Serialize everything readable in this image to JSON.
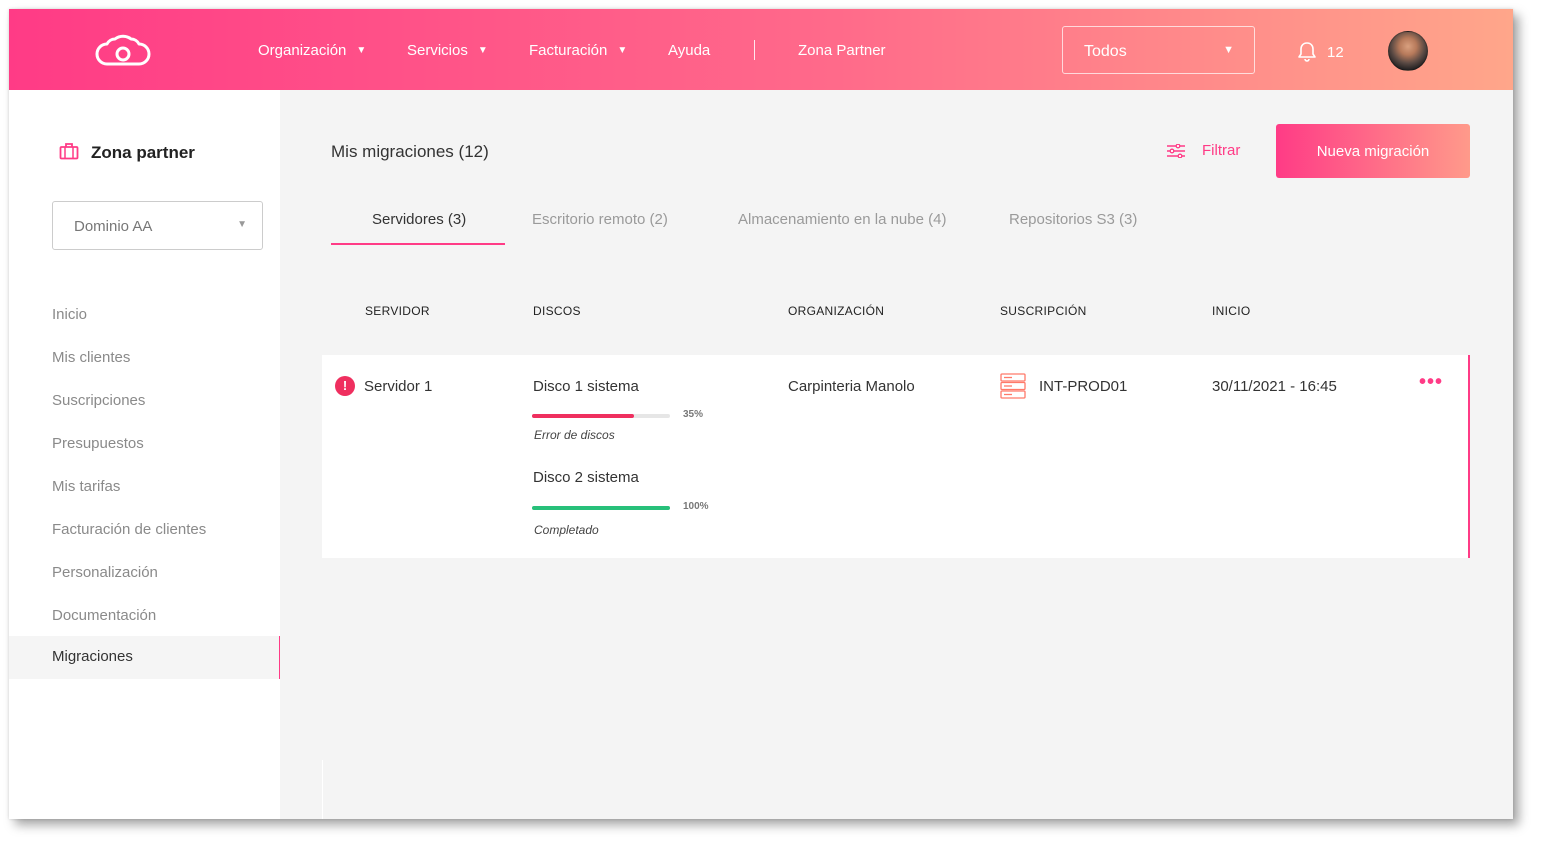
{
  "topbar": {
    "nav": [
      "Organización",
      "Servicios",
      "Facturación",
      "Ayuda",
      "Zona Partner"
    ],
    "org_select": "Todos",
    "notifications": "12"
  },
  "sidebar": {
    "title": "Zona partner",
    "domain_select": "Dominio AA",
    "items": [
      "Inicio",
      "Mis clientes",
      "Suscripciones",
      "Presupuestos",
      "Mis tarifas",
      "Facturación de clientes",
      "Personalización",
      "Documentación",
      "Migraciones"
    ]
  },
  "main": {
    "title": "Mis migraciones (12)",
    "filter_label": "Filtrar",
    "new_button": "Nueva migración",
    "tabs": [
      "Servidores (3)",
      "Escritorio remoto (2)",
      "Almacenamiento en la nube (4)",
      "Repositorios S3 (3)"
    ],
    "columns": [
      "SERVIDOR",
      "DISCOS",
      "ORGANIZACIÓN",
      "SUSCRIPCIÓN",
      "INICIO"
    ],
    "rows": [
      {
        "server": "Servidor 1",
        "disks": [
          {
            "name": "Disco 1 sistema",
            "progress": 0.74,
            "pct": "35%",
            "status": "Error de discos",
            "color": "#ef2f5f"
          },
          {
            "name": "Disco 2 sistema",
            "progress": 1.0,
            "pct": "100%",
            "status": "Completado",
            "color": "#27c07a"
          }
        ],
        "organization": "Carpinteria Manolo",
        "subscription": "INT-PROD01",
        "start": "30/11/2021 - 16:45"
      }
    ]
  },
  "colors": {
    "accent": "#ff3b86",
    "gradient_end": "#ffa68a",
    "error": "#ef2f5f",
    "success": "#27c07a"
  },
  "icons": [
    "cloud-logo-icon",
    "chevron-down-icon",
    "bell-icon",
    "briefcase-icon",
    "filter-sliders-icon",
    "error-icon",
    "server-icon",
    "more-icon"
  ]
}
